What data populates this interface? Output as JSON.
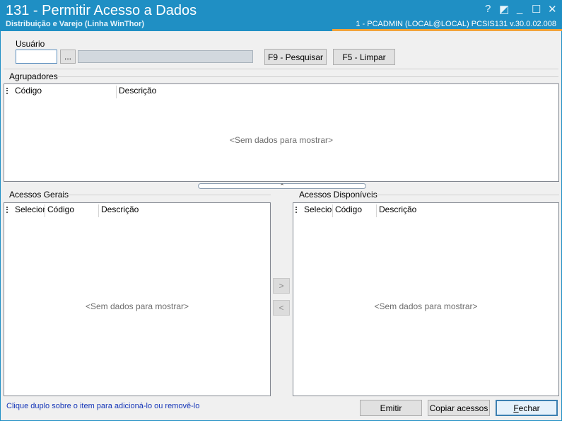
{
  "window": {
    "title": "131 - Permitir Acesso a Dados",
    "subtitle": "Distribuição e Varejo (Linha WinThor)",
    "status": "1 - PCADMIN (LOCAL@LOCAL)   PCSIS131  v.30.0.02.008",
    "controls": {
      "help": "?",
      "restore": "◩",
      "minimize": "_",
      "maximize": "☐",
      "close": "✕"
    }
  },
  "usuario": {
    "label": "Usuário",
    "value": "",
    "browse_label": "...",
    "name_value": ""
  },
  "buttons": {
    "search": "F9 - Pesquisar",
    "clear": "F5 - Limpar",
    "emit": "Emitir",
    "copy": "Copiar acessos",
    "close_prefix": "F",
    "close_rest": "echar"
  },
  "agrupadores": {
    "title": "Agrupadores",
    "columns": [
      "Código",
      "Descrição"
    ],
    "empty": "<Sem dados para mostrar>"
  },
  "gerais": {
    "title": "Acessos Gerais",
    "columns": [
      "Selecionar",
      "Código",
      "Descrição"
    ],
    "empty": "<Sem dados para mostrar>"
  },
  "disponiveis": {
    "title": "Acessos Disponíveis",
    "columns": [
      "Selecionar",
      "Código",
      "Descrição"
    ],
    "empty": "<Sem dados para mostrar>"
  },
  "transfer": {
    "add": ">",
    "remove": "<"
  },
  "splitter": "⌃",
  "hint": "Clique duplo sobre o item para adicioná-lo ou removê-lo"
}
